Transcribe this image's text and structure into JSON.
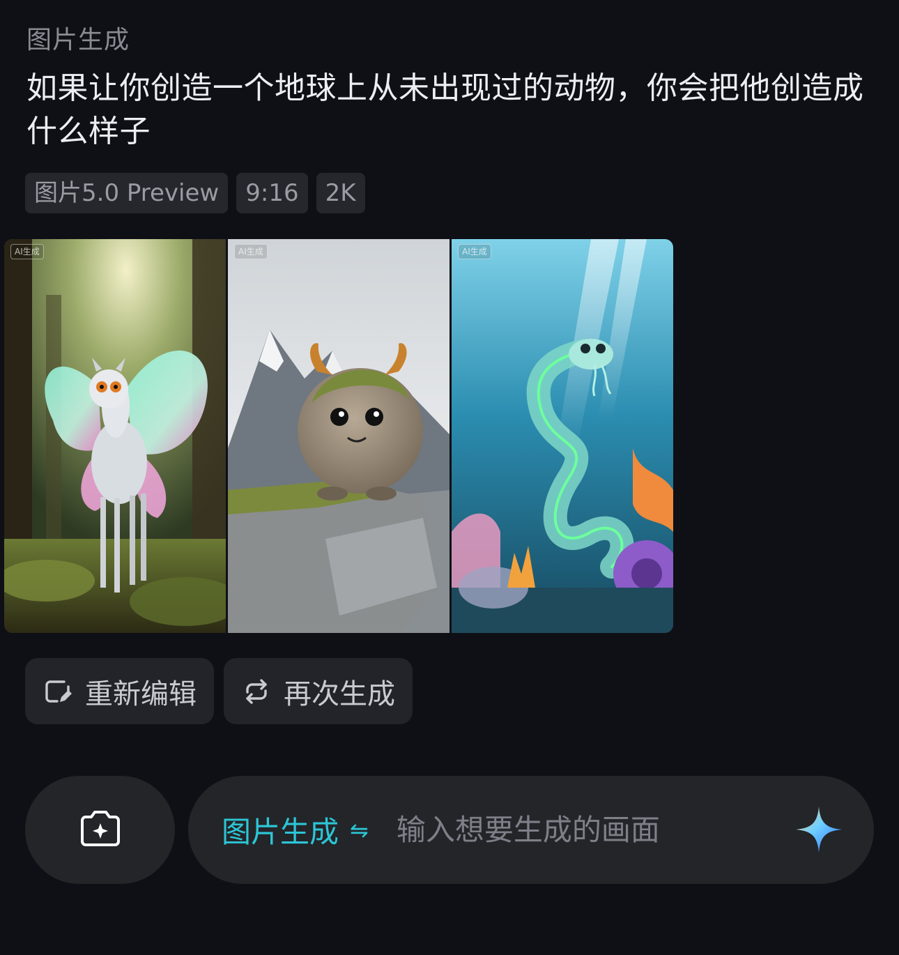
{
  "header": {
    "section_label": "图片生成",
    "prompt_text": "如果让你创造一个地球上从未出现过的动物，你会把他创造成什么样子"
  },
  "tags": [
    "图片5.0 Preview",
    "9:16",
    "2K"
  ],
  "gallery": {
    "badge_label": "AI生成",
    "images": [
      {
        "subject": "owl-deer creature with butterfly wings in forest"
      },
      {
        "subject": "fluffy horned creature on mossy mountain rock"
      },
      {
        "subject": "glowing translucent sea serpent among coral"
      }
    ]
  },
  "actions": {
    "reedit_label": "重新编辑",
    "regenerate_label": "再次生成"
  },
  "composer": {
    "mode_label": "图片生成",
    "swap_glyph": "⇋",
    "placeholder": "输入想要生成的画面"
  },
  "colors": {
    "background": "#0f1016",
    "accent": "#2cc6d6",
    "panel": "#232529"
  },
  "icons": [
    "camera-plus-icon",
    "edit-icon",
    "refresh-icon",
    "swap-icon",
    "sparkle-send-icon"
  ]
}
